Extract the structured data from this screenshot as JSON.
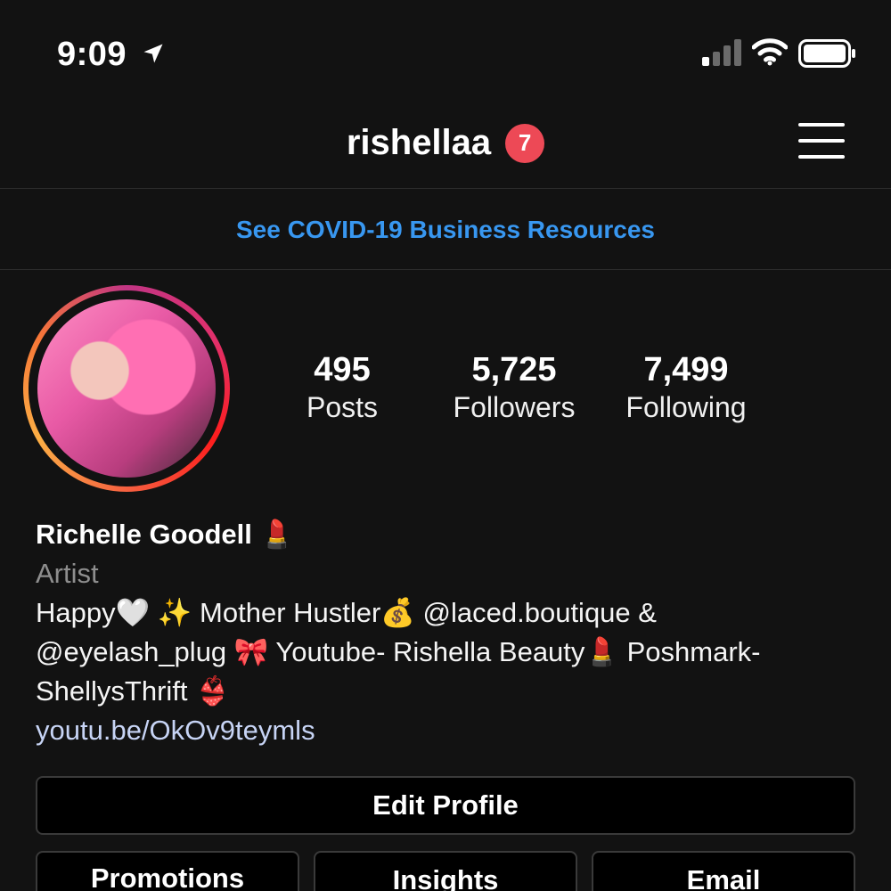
{
  "status_bar": {
    "time": "9:09",
    "location_icon": "location-arrow-icon",
    "signal_icon": "cellular-signal-icon",
    "wifi_icon": "wifi-icon",
    "battery_icon": "battery-icon"
  },
  "header": {
    "username": "rishellaa",
    "notification_count": "7",
    "menu_icon": "hamburger-menu-icon"
  },
  "banner": {
    "text": "See COVID-19 Business Resources"
  },
  "profile": {
    "stats": [
      {
        "value": "495",
        "label": "Posts"
      },
      {
        "value": "5,725",
        "label": "Followers"
      },
      {
        "value": "7,499",
        "label": "Following"
      }
    ],
    "name": "Richelle Goodell 💄",
    "category": "Artist",
    "bio_line1": "Happy🤍 ✨ Mother Hustler💰 @laced.boutique &",
    "bio_line2": "@eyelash_plug 🎀 Youtube- Rishella Beauty💄 Poshmark-",
    "bio_line3": "ShellysThrift 👙",
    "link": "youtu.be/OkOv9teymls"
  },
  "actions": {
    "edit_profile": "Edit Profile",
    "promotions": "Promotions",
    "insights": "Insights",
    "email": "Email"
  },
  "colors": {
    "background": "#121212",
    "link_blue": "#3897f0",
    "badge_red": "#ed4956",
    "muted": "#8e8e8e"
  }
}
